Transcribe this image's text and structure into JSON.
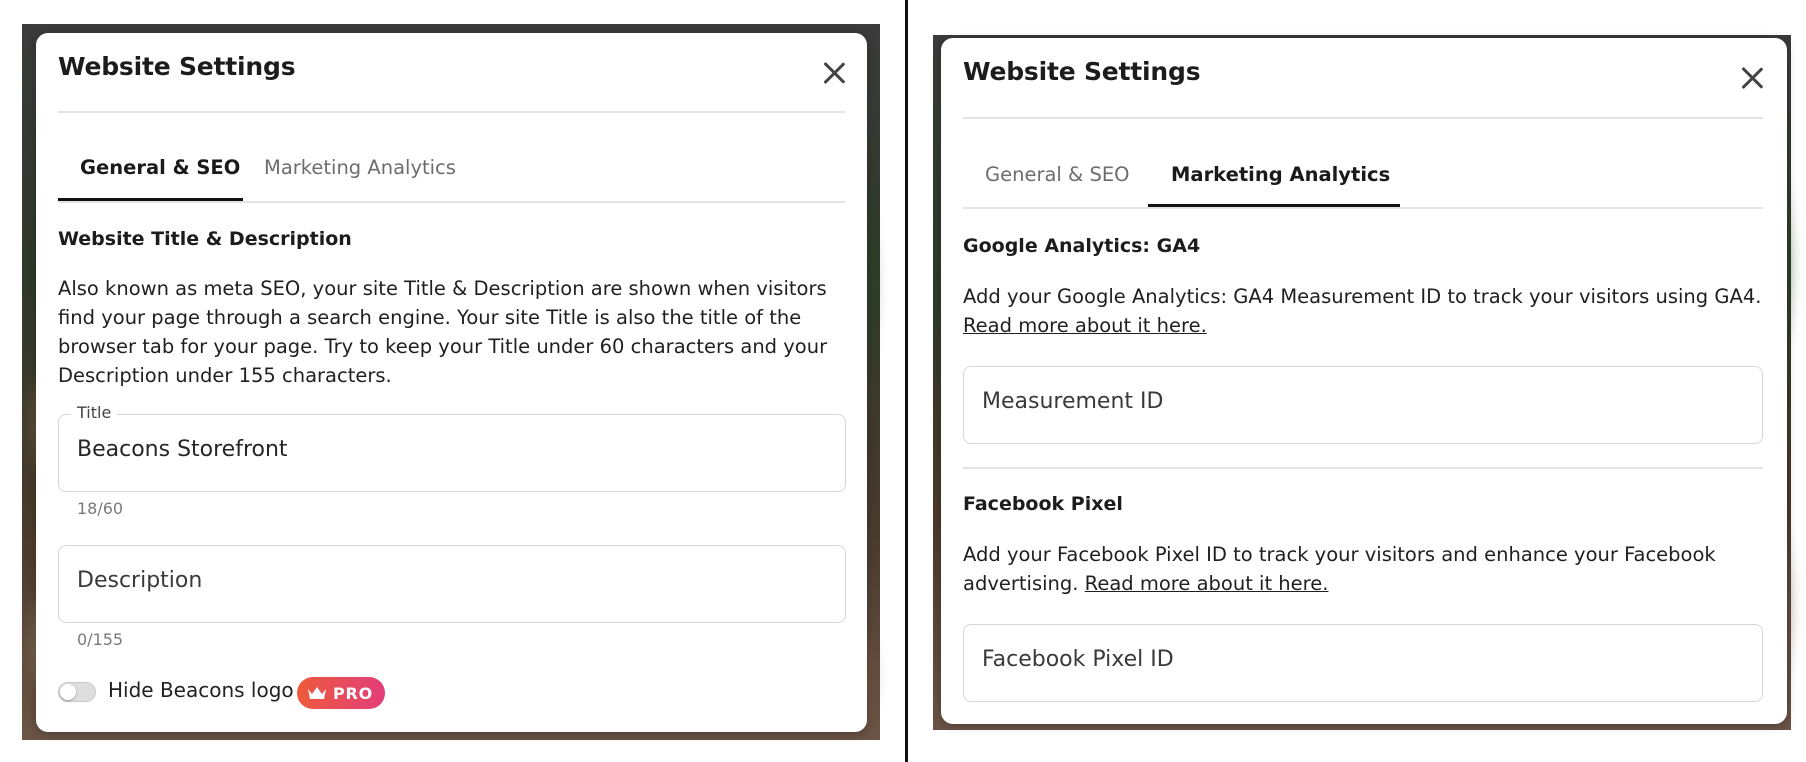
{
  "left_panel": {
    "title": "Website Settings",
    "tabs": [
      {
        "label": "General & SEO",
        "active": true
      },
      {
        "label": "Marketing Analytics",
        "active": false
      }
    ],
    "section_heading": "Website Title & Description",
    "description": "Also known as meta SEO, your site Title & Description are shown when visitors find your page through a search engine. Your site Title is also the title of the browser tab for your page. Try to keep your Title under 60 characters and your Description under 155 characters.",
    "title_field": {
      "legend": "Title",
      "value": "Beacons Storefront",
      "counter": "18/60"
    },
    "description_field": {
      "placeholder": "Description",
      "counter": "0/155"
    },
    "hide_logo": {
      "label": "Hide Beacons logo",
      "enabled": false,
      "badge": "PRO"
    }
  },
  "right_panel": {
    "title": "Website Settings",
    "tabs": [
      {
        "label": "General & SEO",
        "active": false
      },
      {
        "label": "Marketing Analytics",
        "active": true
      }
    ],
    "ga4": {
      "heading": "Google Analytics: GA4",
      "text": "Add your Google Analytics: GA4 Measurement ID to track your visitors using GA4.",
      "link": "Read more about it here.",
      "placeholder": "Measurement ID"
    },
    "facebook": {
      "heading": "Facebook Pixel",
      "text": "Add your Facebook Pixel ID to track your visitors and enhance your Facebook advertising.",
      "link": "Read more about it here.",
      "placeholder": "Facebook Pixel ID"
    }
  },
  "colors": {
    "pro_badge_start": "#ee5a3c",
    "pro_badge_end": "#e23d7a",
    "tab_indicator": "#111111"
  },
  "icons": [
    "close-icon",
    "crown-icon"
  ]
}
